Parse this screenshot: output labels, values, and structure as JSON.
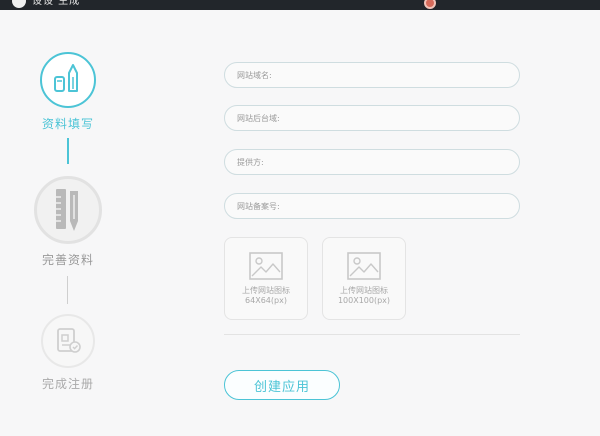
{
  "header": {
    "logo_text": "设设 生成",
    "avatar": "avatar-icon"
  },
  "steps": [
    {
      "label": "资料填写",
      "icon": "pencil-icon",
      "state": "active",
      "color": "#4cc4d6"
    },
    {
      "label": "完善资料",
      "icon": "ruler-pen-icon",
      "state": "pending"
    },
    {
      "label": "完成注册",
      "icon": "certificate-icon",
      "state": "pending"
    }
  ],
  "form": {
    "site_name_placeholder": "网站域名:",
    "backend_domain_placeholder": "网站后台域:",
    "provider_placeholder": "提供方:",
    "icp_placeholder": "网站备案号:",
    "uploads": [
      {
        "line1": "上传网站图标",
        "line2": "64X64(px)"
      },
      {
        "line1": "上传网站图标",
        "line2": "100X100(px)"
      }
    ],
    "submit_label": "创建应用"
  }
}
